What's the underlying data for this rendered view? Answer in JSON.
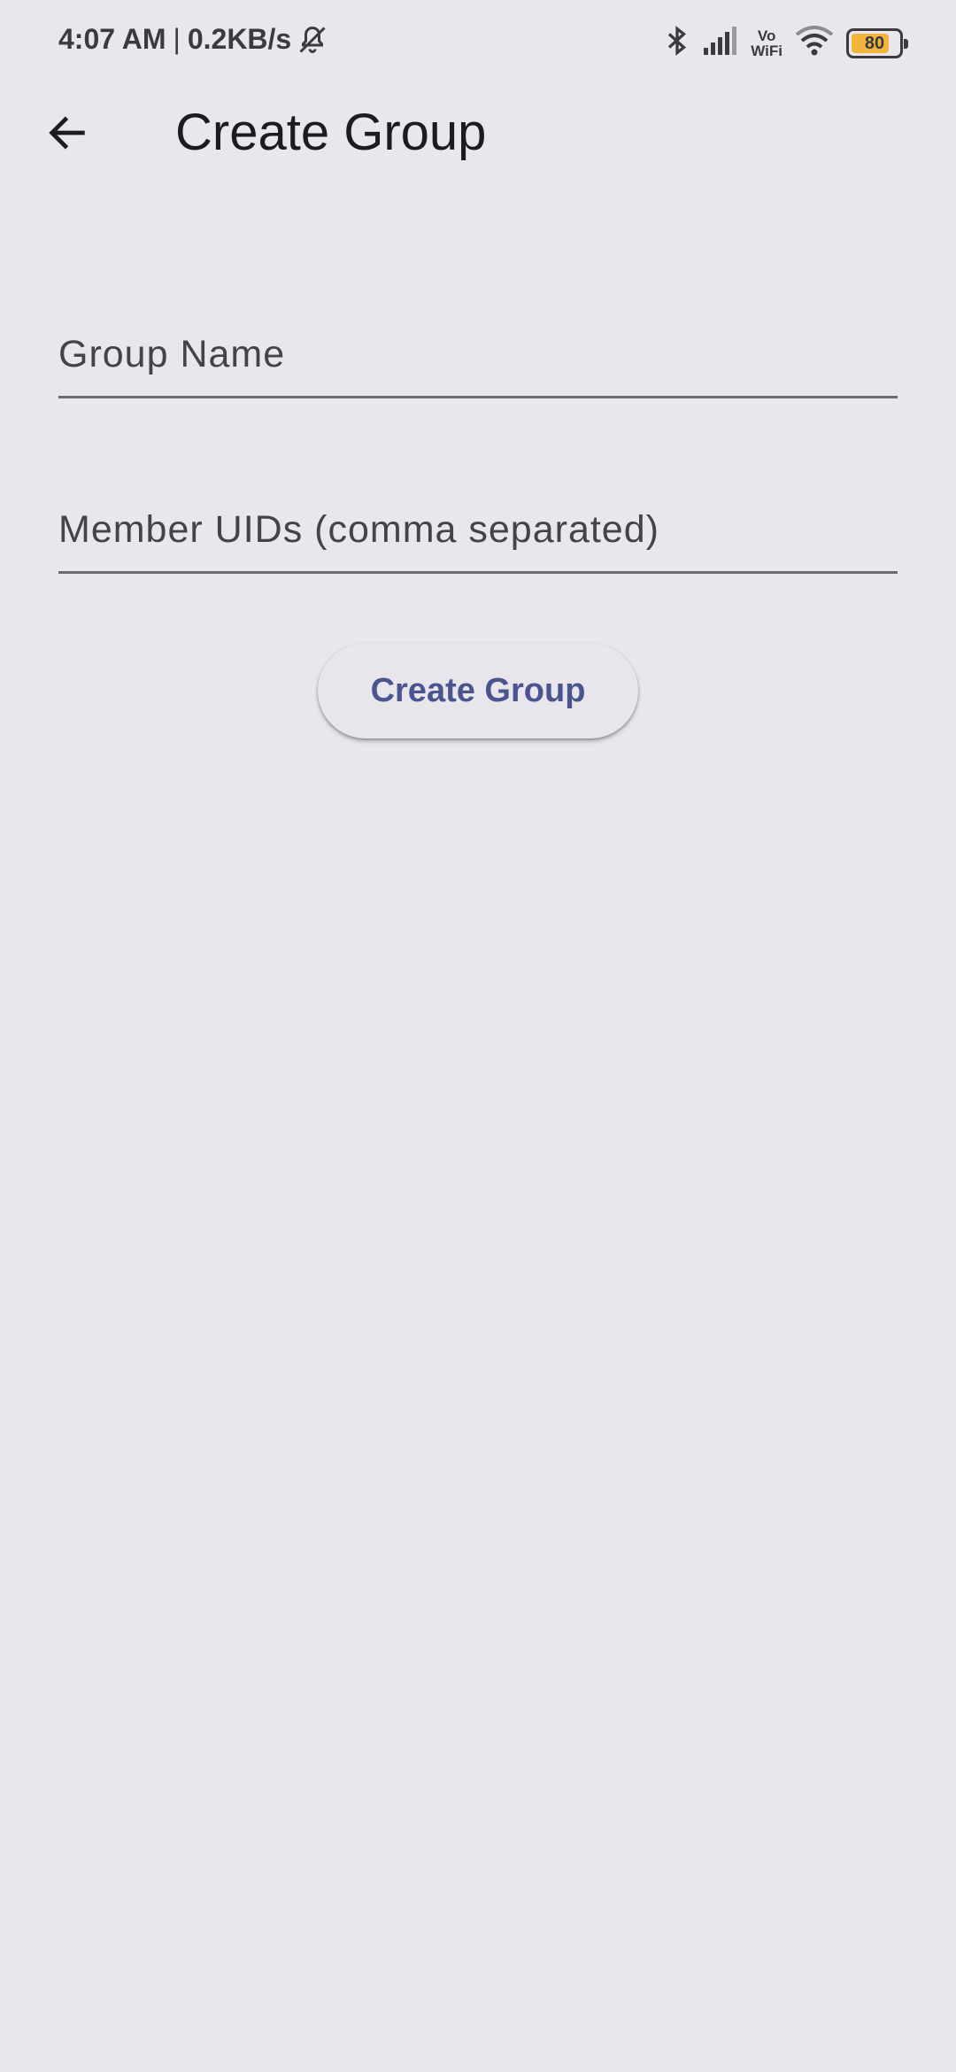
{
  "status_bar": {
    "time": "4:07 AM",
    "separator": "|",
    "network_speed": "0.2KB/s",
    "vowifi_top": "Vo",
    "vowifi_bottom": "WiFi",
    "battery_level": "80",
    "battery_fraction": 0.8,
    "icons": [
      "mute-notification-icon",
      "bluetooth-icon",
      "signal-icon",
      "vowifi-icon",
      "wifi-icon",
      "battery-icon"
    ]
  },
  "app_bar": {
    "title": "Create Group",
    "back_icon": "arrow-left-icon"
  },
  "form": {
    "group_name_label": "Group Name",
    "group_name_value": "",
    "members_label": "Member UIDs (comma separated)",
    "members_value": "",
    "submit_label": "Create Group"
  },
  "colors": {
    "background": "#e9e6ed",
    "button_text": "#4a5590",
    "battery_fill": "#f0b53a",
    "underline": "#6d6a73"
  }
}
